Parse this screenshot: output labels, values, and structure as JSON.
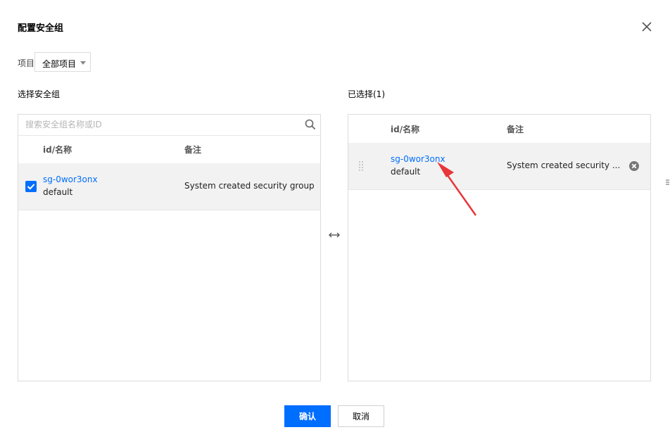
{
  "dialog": {
    "title": "配置安全组"
  },
  "project": {
    "label": "项目",
    "selected": "全部项目"
  },
  "left": {
    "heading": "选择安全组",
    "search_placeholder": "搜索安全组名称或ID",
    "columns": [
      "id/名称",
      "备注"
    ],
    "rows": [
      {
        "checked": true,
        "id": "sg-0wor3onx",
        "name": "default",
        "note": "System created security group"
      }
    ]
  },
  "right": {
    "heading": "已选择(1)",
    "columns": [
      "id/名称",
      "备注"
    ],
    "rows": [
      {
        "id": "sg-0wor3onx",
        "name": "default",
        "note": "System created security ..."
      }
    ]
  },
  "footer": {
    "ok_label": "确认",
    "cancel_label": "取消"
  },
  "colors": {
    "accent": "#006eff",
    "annotation_arrow": "#e8363a"
  },
  "icons": [
    "close-icon",
    "chevron-down-icon",
    "search-icon",
    "check-icon",
    "drag-handle-icon",
    "remove-icon",
    "swap-icon"
  ]
}
